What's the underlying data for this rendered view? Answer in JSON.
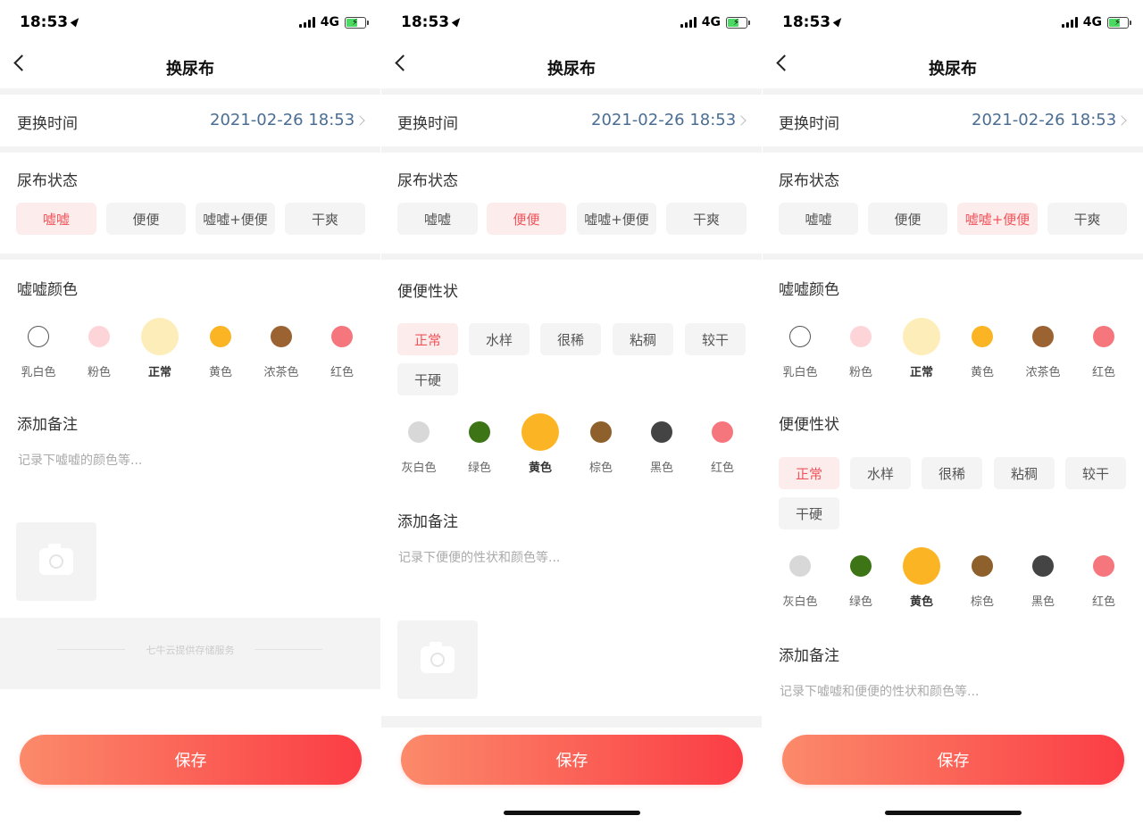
{
  "status": {
    "time": "18:53",
    "network": "4G"
  },
  "nav": {
    "title": "换尿布"
  },
  "change_time": {
    "label": "更换时间",
    "value": "2021-02-26 18:53"
  },
  "diaper_status": {
    "label": "尿布状态",
    "options": [
      "嘘嘘",
      "便便",
      "嘘嘘+便便",
      "干爽"
    ]
  },
  "pee_color": {
    "label": "嘘嘘颜色",
    "options": [
      {
        "name": "乳白色",
        "color": "#ffffff"
      },
      {
        "name": "粉色",
        "color": "#fdd5d8"
      },
      {
        "name": "正常",
        "color": "#fdedb9"
      },
      {
        "name": "黄色",
        "color": "#fbb524"
      },
      {
        "name": "浓茶色",
        "color": "#9b6331"
      },
      {
        "name": "红色",
        "color": "#f6767e"
      }
    ]
  },
  "poop_shape": {
    "label": "便便性状",
    "options": [
      "正常",
      "水样",
      "很稀",
      "粘稠",
      "较干",
      "干硬"
    ]
  },
  "poop_color": {
    "options": [
      {
        "name": "灰白色",
        "color": "#d8d8d8"
      },
      {
        "name": "绿色",
        "color": "#3d7516"
      },
      {
        "name": "黄色",
        "color": "#fbb524"
      },
      {
        "name": "棕色",
        "color": "#8e602c"
      },
      {
        "name": "黑色",
        "color": "#444444"
      },
      {
        "name": "红色",
        "color": "#f6767e"
      }
    ]
  },
  "note": {
    "label": "添加备注",
    "placeholder_pee": "记录下嘘嘘的颜色等...",
    "placeholder_poop": "记录下便便的性状和颜色等...",
    "placeholder_both": "记录下嘘嘘和便便的性状和颜色等..."
  },
  "footer": {
    "text": "七牛云提供存储服务"
  },
  "save": {
    "label": "保存"
  },
  "colors": {
    "accent": "#f0545b",
    "date": "#4a6d93",
    "button_start": "#fb8a6a",
    "button_end": "#fb3d45"
  }
}
